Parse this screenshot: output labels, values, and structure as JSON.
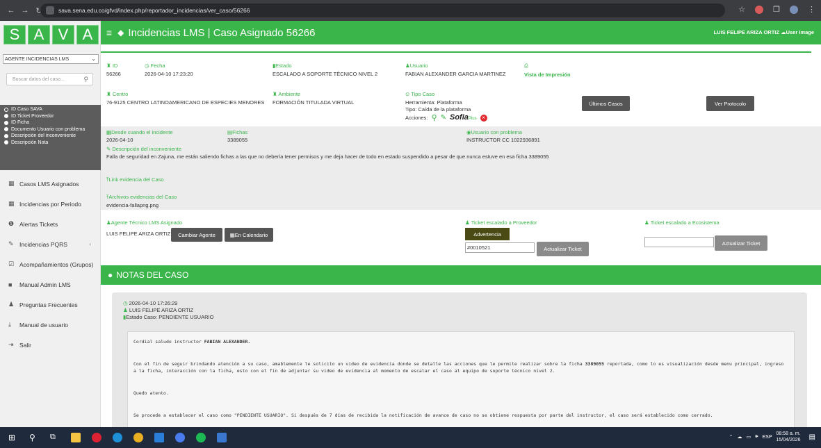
{
  "browser": {
    "url": "sava.sena.edu.co/gfvd/index.php/reportador_incidencias/ver_caso/56266"
  },
  "logo": [
    "S",
    "A",
    "V",
    "A"
  ],
  "sidebar": {
    "role": "AGENTE INCIDENCIAS LMS",
    "search_placeholder": "Buscar datos del caso...",
    "filters": [
      "ID Caso SAVA",
      "ID Ticket Proveedor",
      "ID Ficha",
      "Documento Usuario con problema",
      "Descripción del inconveniente",
      "Descripción Nota"
    ],
    "menu": [
      {
        "label": "Casos LMS Asignados",
        "icon": "calendar-icon"
      },
      {
        "label": "Incidencias por Periodo",
        "icon": "calendar-icon"
      },
      {
        "label": "Alertas Tickets",
        "icon": "alert-circle-icon"
      },
      {
        "label": "Incidencias PQRS",
        "icon": "wrench-icon"
      },
      {
        "label": "Acompañamientos (Grupos)",
        "icon": "checkbox-icon"
      },
      {
        "label": "Manual Admin LMS",
        "icon": "book-icon"
      },
      {
        "label": "Preguntas Frecuentes",
        "icon": "users-icon"
      },
      {
        "label": "Manual de usuario",
        "icon": "download-icon"
      },
      {
        "label": "Salir",
        "icon": "logout-icon"
      }
    ]
  },
  "header": {
    "title": "Incidencias LMS | Caso Asignado 56266",
    "user": "LUIS FELIPE ARIZA ORTIZ",
    "user_image_alt": "User Image"
  },
  "case": {
    "id_label": "ID",
    "id": "56266",
    "fecha_label": "Fecha",
    "fecha": "2026-04-10 17:23:20",
    "estado_label": "Estado",
    "estado": "ESCALADO A SOPORTE TÉCNICO NIVEL 2",
    "usuario_label": "Usuario",
    "usuario": "FABIAN ALEXANDER GARCIA MARTINEZ",
    "print_label": "Vista de Impresión",
    "centro_label": "Centro",
    "centro": "76-9125 CENTRO LATINOAMERICANO DE ESPECIES MENORES",
    "ambiente_label": "Ambiente",
    "ambiente": "FORMACIÓN TITULADA VIRTUAL",
    "tipo_label": "Tipo Caso",
    "herramienta": "Herramienta: Plataforma",
    "tipo": "Tipo: Caída de la plataforma",
    "acciones": "Acciones:",
    "sofia": "Sofia",
    "sofia_plus": "Plus",
    "btn_ultimos": "Últimos Casos",
    "btn_protocolo": "Ver Protocolo",
    "desde_label": "Desde cuando el incidente",
    "desde": "2026-04-10",
    "fichas_label": "Fichas",
    "fichas": "3389055",
    "usuario_problema_label": "Usuario con problema",
    "usuario_problema": "INSTRUCTOR CC 1022936891",
    "desc_label": "Descripción del inconveniente",
    "desc": "Falla de seguridad en Zajuna, me están saliendo fichas a las que no debería tener permisos y me deja hacer de todo en estado suspendido a pesar de que nunca estuve en esa ficha 3389055",
    "link_label": "Link evidencia del Caso",
    "archivos_label": "Archivos evidencias del Caso",
    "archivo": "evidencia-fallapng.png",
    "agente_label": "Agente Técnico LMS Asignado",
    "agente": "LUIS FELIPE ARIZA ORTIZ",
    "btn_cambiar": "Cambiar Agente",
    "btn_calendario": "En Calendario",
    "ticket_prov_label": "Ticket escalado a Proveedor",
    "btn_advertencia": "Advertencia",
    "ticket_prov": "#0010521",
    "btn_actualizar": "Actualizar Ticket",
    "ticket_eco_label": "Ticket escalado a Ecosistema",
    "ticket_eco": "",
    "btn_actualizar2": "Actualizar Ticket"
  },
  "notes": {
    "title": "NOTAS DEL CASO",
    "items": [
      {
        "datetime": "2026-04-10 17:26:29",
        "author": "LUIS FELIPE ARIZA ORTIZ",
        "estado": "Estado Caso: PENDIENTE USUARIO",
        "p1_pre": "Cordial saludo instructor ",
        "p1_bold": "FABIAN ALEXANDER.",
        "p2_pre": "Con el fin de seguir brindando atención a su caso, amablemente le solicito un video de evidencia donde se detalle las acciones que le permite realizar sobre la ficha ",
        "p2_bold": "3389055",
        "p2_post": " reportada, como lo es visualización desde menu principal, ingreso a la ficha, interacción con la ficha, esto con el fin de adjuntar su video de evidencia al momento de escalar el caso al equipo de soporte técnico nivel 2.",
        "p3": "Quedo atento.",
        "p4": "Se procede a establecer el caso como \"PENDIENTE USUARIO\". Si después de 7 días de recibida la notificación de avance de caso no se obtiene respuesta por parte del instructor, el caso será establecido como cerrado."
      }
    ]
  },
  "taskbar": {
    "lang": "ESP",
    "time": "08:58 a. m.",
    "date": "15/04/2026"
  }
}
